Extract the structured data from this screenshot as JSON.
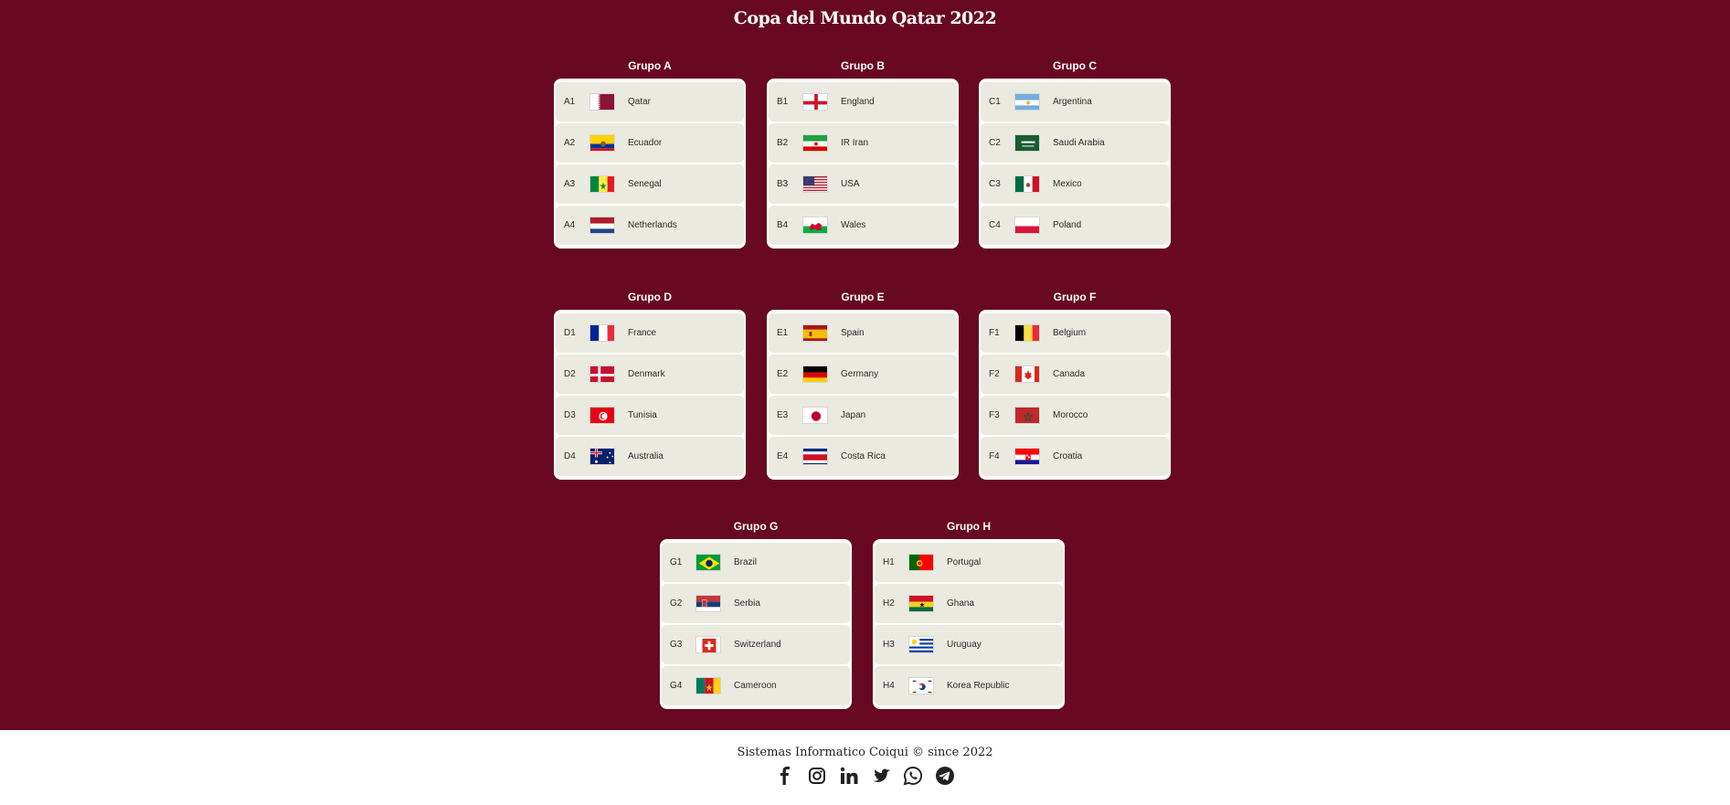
{
  "title": "Copa del Mundo Qatar 2022",
  "groups": [
    {
      "name": "Grupo A",
      "teams": [
        {
          "code": "A1",
          "name": "Qatar",
          "flag": "qatar-flag"
        },
        {
          "code": "A2",
          "name": "Ecuador",
          "flag": "ecuador-flag"
        },
        {
          "code": "A3",
          "name": "Senegal",
          "flag": "senegal-flag"
        },
        {
          "code": "A4",
          "name": "Netherlands",
          "flag": "netherlands-flag"
        }
      ]
    },
    {
      "name": "Grupo B",
      "teams": [
        {
          "code": "B1",
          "name": "England",
          "flag": "england-flag"
        },
        {
          "code": "B2",
          "name": "IR Iran",
          "flag": "iran-flag"
        },
        {
          "code": "B3",
          "name": "USA",
          "flag": "usa-flag"
        },
        {
          "code": "B4",
          "name": "Wales",
          "flag": "wales-flag"
        }
      ]
    },
    {
      "name": "Grupo C",
      "teams": [
        {
          "code": "C1",
          "name": "Argentina",
          "flag": "argentina-flag"
        },
        {
          "code": "C2",
          "name": "Saudi Arabia",
          "flag": "saudi-arabia-flag"
        },
        {
          "code": "C3",
          "name": "Mexico",
          "flag": "mexico-flag"
        },
        {
          "code": "C4",
          "name": "Poland",
          "flag": "poland-flag"
        }
      ]
    },
    {
      "name": "Grupo D",
      "teams": [
        {
          "code": "D1",
          "name": "France",
          "flag": "france-flag"
        },
        {
          "code": "D2",
          "name": "Denmark",
          "flag": "denmark-flag"
        },
        {
          "code": "D3",
          "name": "Tunisia",
          "flag": "tunisia-flag"
        },
        {
          "code": "D4",
          "name": "Australia",
          "flag": "australia-flag"
        }
      ]
    },
    {
      "name": "Grupo E",
      "teams": [
        {
          "code": "E1",
          "name": "Spain",
          "flag": "spain-flag"
        },
        {
          "code": "E2",
          "name": "Germany",
          "flag": "germany-flag"
        },
        {
          "code": "E3",
          "name": "Japan",
          "flag": "japan-flag"
        },
        {
          "code": "E4",
          "name": "Costa Rica",
          "flag": "costa-rica-flag"
        }
      ]
    },
    {
      "name": "Grupo F",
      "teams": [
        {
          "code": "F1",
          "name": "Belgium",
          "flag": "belgium-flag"
        },
        {
          "code": "F2",
          "name": "Canada",
          "flag": "canada-flag"
        },
        {
          "code": "F3",
          "name": "Morocco",
          "flag": "morocco-flag"
        },
        {
          "code": "F4",
          "name": "Croatia",
          "flag": "croatia-flag"
        }
      ]
    },
    {
      "name": "Grupo G",
      "teams": [
        {
          "code": "G1",
          "name": "Brazil",
          "flag": "brazil-flag"
        },
        {
          "code": "G2",
          "name": "Serbia",
          "flag": "serbia-flag"
        },
        {
          "code": "G3",
          "name": "Switzerland",
          "flag": "switzerland-flag"
        },
        {
          "code": "G4",
          "name": "Cameroon",
          "flag": "cameroon-flag"
        }
      ]
    },
    {
      "name": "Grupo H",
      "teams": [
        {
          "code": "H1",
          "name": "Portugal",
          "flag": "portugal-flag"
        },
        {
          "code": "H2",
          "name": "Ghana",
          "flag": "ghana-flag"
        },
        {
          "code": "H3",
          "name": "Uruguay",
          "flag": "uruguay-flag"
        },
        {
          "code": "H4",
          "name": "Korea Republic",
          "flag": "korea-republic-flag"
        }
      ]
    }
  ],
  "footer": {
    "text": "Sistemas Informatico Coiqui © since 2022",
    "socials": [
      "facebook-icon",
      "instagram-icon",
      "linkedin-icon",
      "twitter-icon",
      "whatsapp-icon",
      "telegram-icon"
    ]
  },
  "colors": {
    "background": "#680822",
    "card": "#ffffff",
    "row": "#ebeae1"
  }
}
